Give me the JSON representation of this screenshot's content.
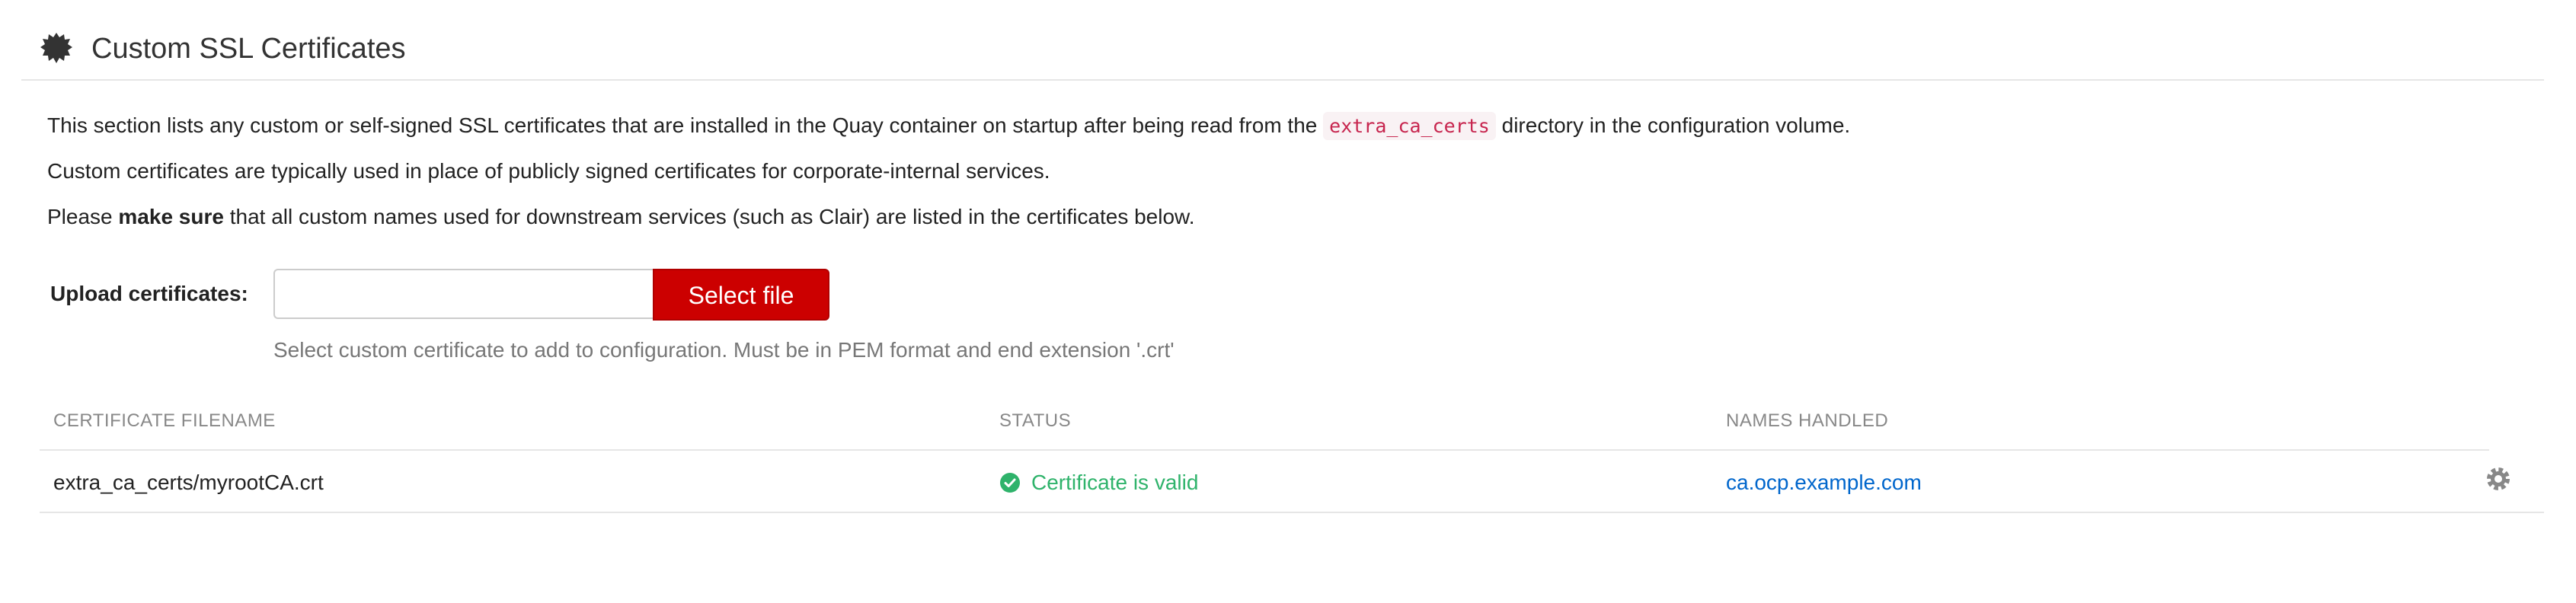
{
  "header": {
    "title": "Custom SSL Certificates",
    "icon": "certificate-seal-icon"
  },
  "description": {
    "line1_before": "This section lists any custom or self-signed SSL certificates that are installed in the Quay container on startup after being read from the ",
    "line1_code": "extra_ca_certs",
    "line1_after": " directory in the configuration volume.",
    "line2": "Custom certificates are typically used in place of publicly signed certificates for corporate-internal services.",
    "line3_before": "Please ",
    "line3_bold": "make sure",
    "line3_after": " that all custom names used for downstream services (such as Clair) are listed in the certificates below."
  },
  "upload": {
    "label": "Upload certificates:",
    "file_value": "",
    "button_label": "Select file",
    "help": "Select custom certificate to add to configuration. Must be in PEM format and end extension '.crt'"
  },
  "table": {
    "columns": [
      "CERTIFICATE FILENAME",
      "STATUS",
      "NAMES HANDLED"
    ],
    "rows": [
      {
        "filename": "extra_ca_certs/myrootCA.crt",
        "status": "Certificate is valid",
        "status_icon": "check-circle-icon",
        "names": "ca.ocp.example.com",
        "action_icon": "gear-icon"
      }
    ]
  },
  "colors": {
    "accent": "#cc0000",
    "valid": "#2fb36b",
    "link": "#0066cc",
    "code": "#c7254e"
  }
}
